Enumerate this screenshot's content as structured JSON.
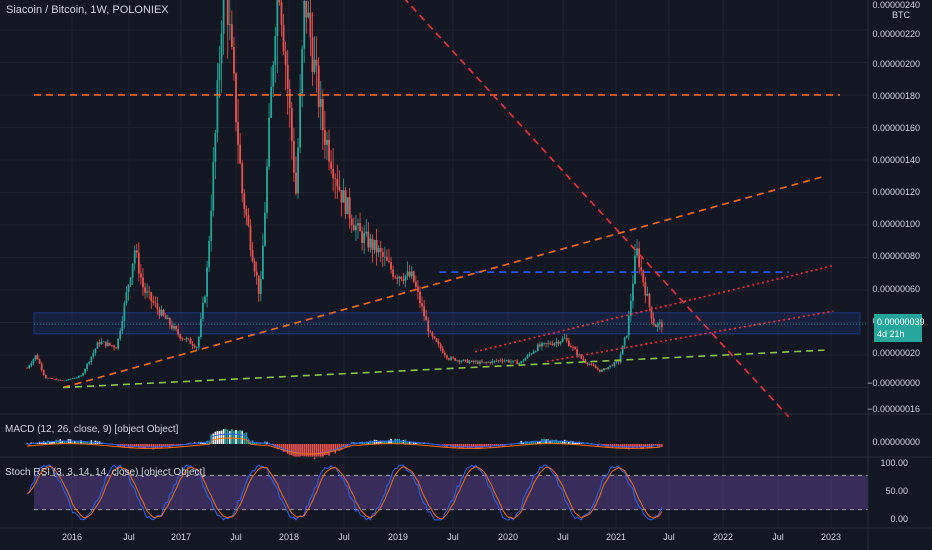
{
  "header": {
    "title": "Siacoin / Bitcoin, 1W, POLONIEX"
  },
  "axis": {
    "currency": "BTC",
    "top_partial": "0.00000240",
    "last_price": "0.00000039",
    "last_countdown": "4d 21h"
  },
  "chart_data": [
    {
      "type": "candlestick",
      "title": "Siacoin / Bitcoin, 1W, POLONIEX",
      "yunit": "BTC",
      "xlabels": [
        "2016",
        "Jul",
        "2017",
        "Jul",
        "2018",
        "Jul",
        "2019",
        "Jul",
        "2020",
        "Jul",
        "2021",
        "Jul",
        "2022",
        "Jul",
        "2023"
      ],
      "ytick_labels": [
        "0.00000220",
        "0.00000200",
        "0.00000180",
        "0.00000160",
        "0.00000140",
        "0.00000120",
        "0.00000100",
        "0.00000080",
        "0.00000060",
        "0.00000040",
        "0.00000020",
        "−0.00000000",
        "−0.00000016"
      ],
      "ylim": [
        -1.8e-07,
        2.4e-06
      ],
      "last_value": 3.9e-07,
      "approx_close_path": [
        [
          "2015-08",
          1.2e-07
        ],
        [
          "2015-09",
          2e-07
        ],
        [
          "2015-10",
          6e-08
        ],
        [
          "2015-12",
          4e-08
        ],
        [
          "2016-02",
          7e-08
        ],
        [
          "2016-04",
          2.8e-07
        ],
        [
          "2016-06",
          2.5e-07
        ],
        [
          "2016-08",
          8.5e-07
        ],
        [
          "2016-09",
          6e-07
        ],
        [
          "2016-11",
          4.5e-07
        ],
        [
          "2017-01",
          3.2e-07
        ],
        [
          "2017-03",
          2.5e-07
        ],
        [
          "2017-04",
          6.5e-07
        ],
        [
          "2017-05",
          1.55e-06
        ],
        [
          "2017-06",
          2.6e-06
        ],
        [
          "2017-08",
          1.2e-06
        ],
        [
          "2017-10",
          5.5e-07
        ],
        [
          "2017-12",
          2.6e-06
        ],
        [
          "2018-02",
          1.2e-06
        ],
        [
          "2018-03",
          2.4e-06
        ],
        [
          "2018-05",
          1.6e-06
        ],
        [
          "2018-07",
          1.2e-06
        ],
        [
          "2018-09",
          9.5e-07
        ],
        [
          "2018-11",
          8.5e-07
        ],
        [
          "2019-01",
          7e-07
        ],
        [
          "2019-03",
          6.8e-07
        ],
        [
          "2019-05",
          3.2e-07
        ],
        [
          "2019-07",
          1.8e-07
        ],
        [
          "2019-09",
          1.6e-07
        ],
        [
          "2019-11",
          1.5e-07
        ],
        [
          "2020-01",
          1.7e-07
        ],
        [
          "2020-03",
          1.5e-07
        ],
        [
          "2020-05",
          2.5e-07
        ],
        [
          "2020-07",
          2.8e-07
        ],
        [
          "2020-08",
          3e-07
        ],
        [
          "2020-10",
          1.7e-07
        ],
        [
          "2020-12",
          1e-07
        ],
        [
          "2021-02",
          1.6e-07
        ],
        [
          "2021-03",
          3.5e-07
        ],
        [
          "2021-04",
          8.5e-07
        ],
        [
          "2021-05",
          6e-07
        ],
        [
          "2021-06",
          3.8e-07
        ],
        [
          "2021-07",
          3.9e-07
        ]
      ],
      "price_lines": [
        {
          "kind": "horizontal",
          "style": "dashed",
          "color": "#ff6d1f",
          "y": 1.8e-06
        },
        {
          "kind": "horizontal",
          "style": "dashed",
          "color": "#2962ff",
          "from": "2019-06",
          "to": "2022-09",
          "y": 7.1e-07
        },
        {
          "kind": "trend",
          "style": "dashed",
          "color": "#ff6d1f",
          "from": [
            "2015-12",
            0.0
          ],
          "to": [
            "2023-01",
            1.3e-06
          ]
        },
        {
          "kind": "trend",
          "style": "dashed",
          "color": "#8bc34a",
          "from": [
            "2015-12",
            0.0
          ],
          "to": [
            "2023-01",
            2.3e-07
          ]
        },
        {
          "kind": "trend",
          "style": "dashed",
          "color": "#f23645",
          "from": [
            "2019-02",
            2.4e-06
          ],
          "to": [
            "2022-09",
            -1.8e-07
          ]
        },
        {
          "kind": "trend",
          "style": "dotted",
          "color": "#f23645",
          "from": [
            "2019-10",
            2.2e-07
          ],
          "to": [
            "2023-02",
            7.5e-07
          ]
        },
        {
          "kind": "trend",
          "style": "dotted",
          "color": "#f23645",
          "from": [
            "2020-06",
            1.6e-07
          ],
          "to": [
            "2023-02",
            4.7e-07
          ]
        }
      ],
      "zone": {
        "from_value": 3.3e-07,
        "to_value": 4.6e-07,
        "color": "#2962ff"
      }
    },
    {
      "type": "histogram",
      "title": "MACD (12, 26, close, 9) [object Object]",
      "ytick_labels": [
        "0.00000000"
      ],
      "series": [
        {
          "name": "MACD",
          "color": "#2962ff"
        },
        {
          "name": "Signal",
          "color": "#ff6d00"
        }
      ]
    },
    {
      "type": "line",
      "title": "Stoch RSI (3, 3, 14, 14, close) [object Object]",
      "ytick_labels": [
        "100.00",
        "50.00",
        "0.00"
      ],
      "ylim": [
        0,
        100
      ],
      "bands": [
        20,
        80
      ],
      "series": [
        {
          "name": "K",
          "color": "#2962ff"
        },
        {
          "name": "D",
          "color": "#ff6d00"
        }
      ]
    }
  ],
  "colors": {
    "background": "#131722",
    "up": "#26a69a",
    "down": "#ef5350",
    "grid": "#1e222d"
  }
}
